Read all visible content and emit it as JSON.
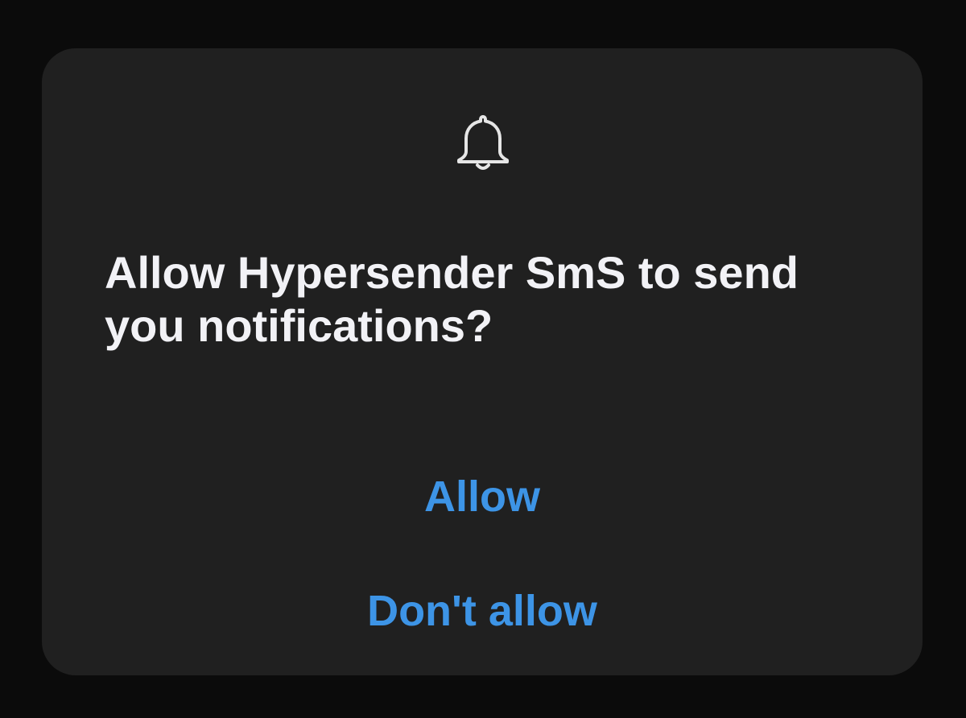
{
  "dialog": {
    "icon": "bell-icon",
    "title": "Allow Hypersender SmS to send you notifications?",
    "buttons": {
      "allow": "Allow",
      "deny": "Don't allow"
    }
  },
  "colors": {
    "screen_background": "#0b0b0b",
    "dialog_background": "#202020",
    "title_text": "#f2f2f6",
    "accent": "#3d94e6",
    "icon": "#e6e6e6"
  }
}
